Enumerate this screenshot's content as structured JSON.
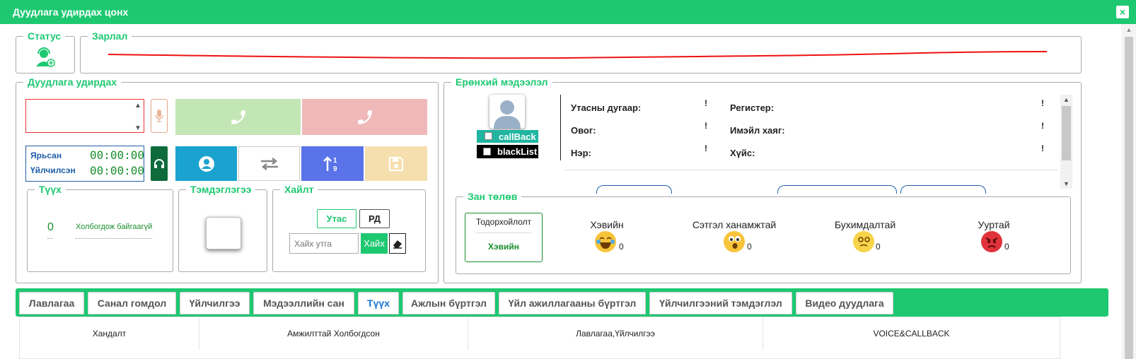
{
  "window": {
    "title": "Дуудлага удирдах цонх",
    "close_icon": "×"
  },
  "status": {
    "legend": "Статус",
    "icon": "operator-headset-icon"
  },
  "zarlal": {
    "legend": "Зарлал"
  },
  "call_control": {
    "legend": "Дуудлага удирдах",
    "talking_label": "Ярьсан",
    "talking_time": "00:00:00",
    "served_label": "Үйлчилсэн",
    "served_time": "00:00:00",
    "answer_color": "#c3e6b5",
    "hangup_color": "#f0b9b9",
    "profile_color": "#1aa3cf",
    "transfer_color": "#ffffff",
    "sort_color": "#5a73e8",
    "save_color": "#f5dfae"
  },
  "history": {
    "legend": "Түүх",
    "count": "0",
    "status": "Холбогдож байгаагүй"
  },
  "note": {
    "legend": "Тэмдэглэгээ"
  },
  "search": {
    "legend": "Хайлт",
    "phone_btn": "Утас",
    "rd_btn": "РД",
    "placeholder": "Хайх утга",
    "search_btn": "Хайх"
  },
  "general": {
    "legend": "Ерөнхий мэдээлэл",
    "callback_label": "callBack",
    "blacklist_label": "blackList",
    "phone_label": "Утасны дугаар:",
    "lastname_label": "Овог:",
    "name_label": "Нэр:",
    "register_label": "Регистер:",
    "email_label": "Имэйл хаяг:",
    "gender_label": "Хүйс:",
    "empty_value": "!"
  },
  "satisfaction": {
    "legend": "Зан төлөв",
    "unknown": "Тодорхойлолт",
    "current": "Хэвийн",
    "items": [
      {
        "label": "Хэвийн",
        "count": "0",
        "icon": "laughing-emoji-icon"
      },
      {
        "label": "Сэтгэл ханамжтай",
        "count": "0",
        "icon": "surprised-emoji-icon"
      },
      {
        "label": "Бухимдалтай",
        "count": "0",
        "icon": "dizzy-emoji-icon"
      },
      {
        "label": "Ууртай",
        "count": "0",
        "icon": "angry-emoji-icon"
      }
    ]
  },
  "tabs": [
    {
      "label": "Лавлагаа"
    },
    {
      "label": "Санал гомдол"
    },
    {
      "label": "Үйлчилгээ"
    },
    {
      "label": "Мэдээллийн сан"
    },
    {
      "label": "Түүх"
    },
    {
      "label": "Ажлын бүртгэл"
    },
    {
      "label": "Үйл ажиллагааны бүртгэл"
    },
    {
      "label": "Үйлчилгээний тэмдэглэл"
    },
    {
      "label": "Видео дуудлага"
    }
  ],
  "table": {
    "headers": [
      "Хандалт",
      "Амжилттай Холбогдсон",
      "Лавлагаа,Үйлчилгээ",
      "VOICE&CALLBACK"
    ]
  }
}
